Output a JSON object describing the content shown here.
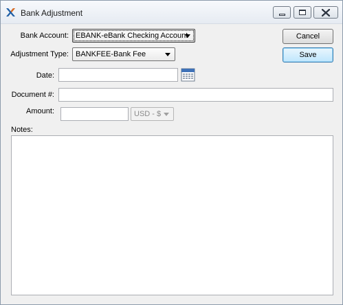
{
  "window": {
    "title": "Bank Adjustment",
    "app_icon": "xtuple-x-icon",
    "controls": [
      "minimize-icon",
      "maximize-icon",
      "close-icon"
    ]
  },
  "form": {
    "bank_account": {
      "label": "Bank Account:",
      "value": "EBANK-eBank Checking Account"
    },
    "adjustment_type": {
      "label": "Adjustment Type:",
      "value": "BANKFEE-Bank Fee"
    },
    "date": {
      "label": "Date:",
      "value": "",
      "icon": "calendar-icon"
    },
    "document_number": {
      "label": "Document #:",
      "value": ""
    },
    "amount": {
      "label": "Amount:",
      "value": "",
      "currency": "USD - $"
    },
    "notes": {
      "label": "Notes:",
      "value": ""
    }
  },
  "buttons": {
    "cancel_label": "Cancel",
    "save_label": "Save"
  },
  "colors": {
    "window_bg": "#f0f0f0",
    "default_button": "#3c7fb1",
    "icon_accent": "#1f5fa6"
  }
}
